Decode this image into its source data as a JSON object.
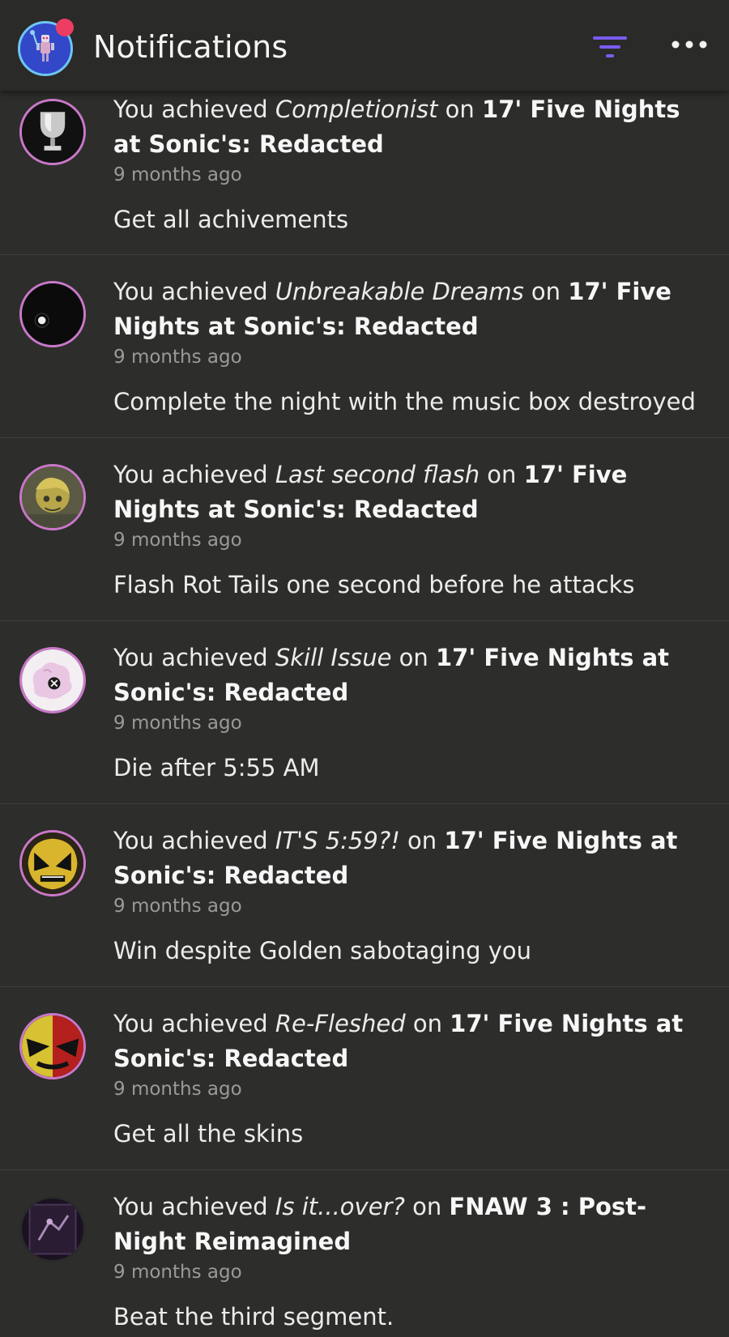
{
  "header": {
    "title": "Notifications",
    "accent_color": "#7b5cf0",
    "notification_dot_color": "#ee3d62"
  },
  "notifications": [
    {
      "prefix": "You achieved ",
      "achievement": "Completionist",
      "on": " on ",
      "game": "17' Five Nights at Sonic's: Redacted",
      "time": "9 months ago",
      "description": "Get all achivements",
      "icon": "trophy-icon"
    },
    {
      "prefix": "You achieved ",
      "achievement": "Unbreakable Dreams",
      "on": " on ",
      "game": "17' Five Nights at Sonic's: Redacted",
      "time": "9 months ago",
      "description": "Complete the night with the music box destroyed",
      "icon": "dark-eye-icon"
    },
    {
      "prefix": "You achieved ",
      "achievement": "Last second flash",
      "on": " on ",
      "game": "17' Five Nights at Sonic's: Redacted",
      "time": "9 months ago",
      "description": "Flash Rot Tails one second before he attacks",
      "icon": "rot-tails-icon"
    },
    {
      "prefix": "You achieved ",
      "achievement": "Skill Issue",
      "on": " on ",
      "game": "17' Five Nights at Sonic's: Redacted",
      "time": "9 months ago",
      "description": "Die after 5:55 AM",
      "icon": "pink-ghost-icon"
    },
    {
      "prefix": "You achieved ",
      "achievement": "IT'S 5:59?!",
      "on": " on ",
      "game": "17' Five Nights at Sonic's: Redacted",
      "time": "9 months ago",
      "description": "Win despite Golden sabotaging you",
      "icon": "golden-face-icon"
    },
    {
      "prefix": "You achieved ",
      "achievement": "Re-Fleshed",
      "on": " on ",
      "game": "17' Five Nights at Sonic's: Redacted",
      "time": "9 months ago",
      "description": "Get all the skins",
      "icon": "split-face-icon"
    },
    {
      "prefix": "You achieved ",
      "achievement": "Is it...over?",
      "on": " on ",
      "game": "FNAW 3 : Post-Night Reimagined",
      "time": "9 months ago",
      "description": "Beat the third segment.",
      "icon": "dark-room-icon"
    }
  ]
}
